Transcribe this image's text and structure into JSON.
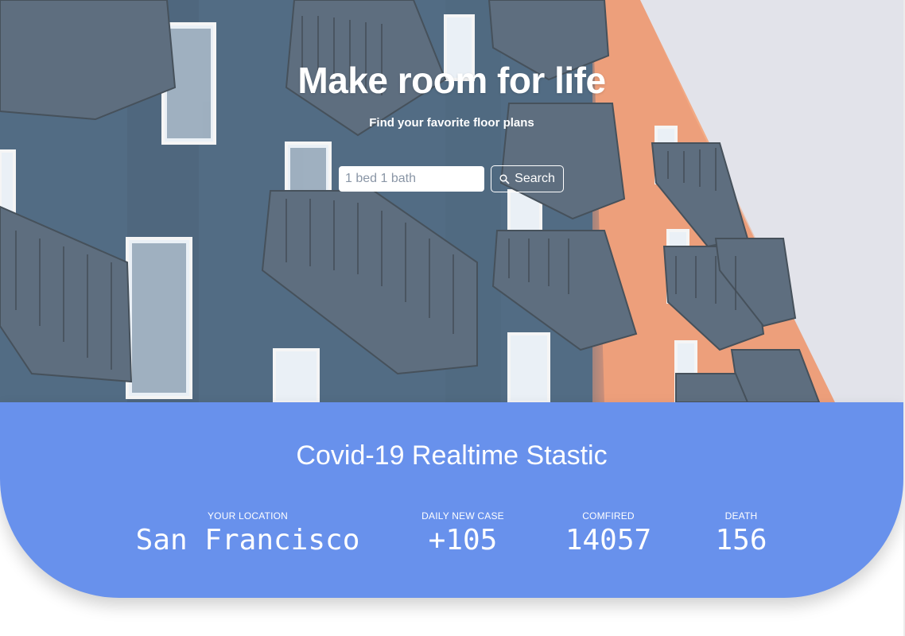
{
  "hero": {
    "title": "Make room for life",
    "subtitle": "Find your favorite floor plans",
    "search": {
      "placeholder": "1 bed 1 bath",
      "value": "",
      "button_label": "Search",
      "button_icon": "search-icon"
    }
  },
  "covid": {
    "title": "Covid-19 Realtime Stastic",
    "stats": [
      {
        "label": "Your Location",
        "value": "San Francisco"
      },
      {
        "label": "Daily New Case",
        "value": "+105"
      },
      {
        "label": "Comfired",
        "value": "14057"
      },
      {
        "label": "Death",
        "value": "156"
      }
    ]
  },
  "colors": {
    "accent": "#6891ec",
    "text_on_accent": "#ffffff"
  }
}
